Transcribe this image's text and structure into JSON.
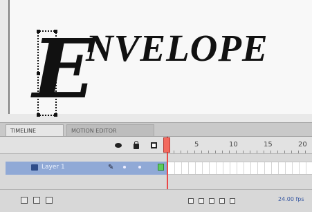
{
  "stage": {
    "big_letter": "E",
    "word": "NVELOPE"
  },
  "timeline": {
    "tabs": [
      {
        "label": "TIMELINE"
      },
      {
        "label": "MOTION EDITOR"
      }
    ],
    "ruler_labels": [
      "5",
      "10",
      "15",
      "20"
    ],
    "layer": {
      "name": "Layer 1"
    },
    "status_text": "24.00 fps"
  },
  "colors": {
    "selected_layer": "#90a9d6",
    "playhead": "#ea4848",
    "keyframe": "#5dcb5d"
  }
}
